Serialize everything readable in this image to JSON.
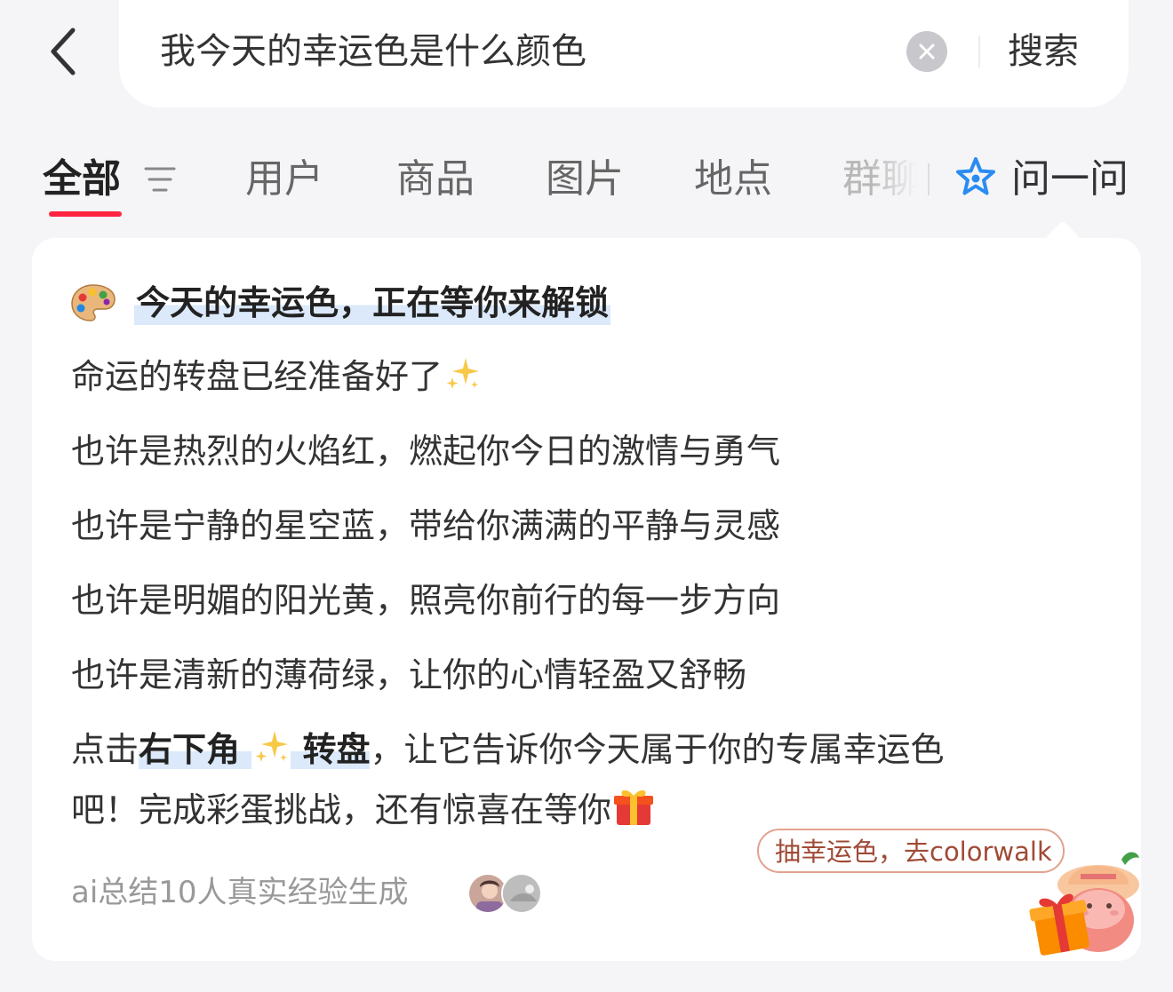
{
  "search": {
    "query": "我今天的幸运色是什么颜色",
    "button_label": "搜索"
  },
  "tabs": [
    {
      "label": "全部"
    },
    {
      "label": "用户"
    },
    {
      "label": "商品"
    },
    {
      "label": "图片"
    },
    {
      "label": "地点"
    },
    {
      "label": "群聊"
    },
    {
      "label": "问一问"
    }
  ],
  "card": {
    "title": "今天的幸运色，正在等你来解锁",
    "lines": [
      "命运的转盘已经准备好了",
      "也许是热烈的火焰红，燃起你今日的激情与勇气",
      "也许是宁静的星空蓝，带给你满满的平静与灵感",
      "也许是明媚的阳光黄，照亮你前行的每一步方向",
      "也许是清新的薄荷绿，让你的心情轻盈又舒畅"
    ],
    "cta_line": {
      "prefix": "点击",
      "hl1": "右下角 ",
      "hl2": " 转盘",
      "suffix": "，让它告诉你今天属于你的专属幸运色",
      "line2": "吧！完成彩蛋挑战，还有惊喜在等你"
    },
    "cta_pill": "抽幸运色，去colorwalk",
    "footer": "ai总结10人真实经验生成"
  },
  "colors": {
    "accent_red": "#ff2442",
    "highlight_blue": "#dbe9fa",
    "ask_icon_blue": "#2a8cf0"
  },
  "icons": {
    "back": "chevron-left-icon",
    "clear": "clear-icon",
    "filter": "filter-icon",
    "ask": "ai-star-icon",
    "palette": "palette-icon",
    "sparkle": "sparkle-icon",
    "gift": "gift-icon"
  }
}
